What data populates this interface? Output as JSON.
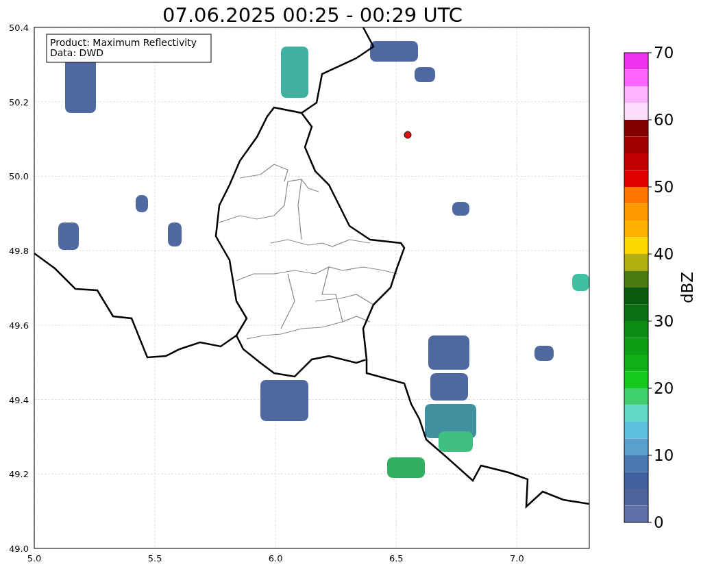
{
  "title": "07.06.2025 00:25 - 00:29 UTC",
  "map": {
    "info_lines": [
      "Product: Maximum Reflectivity",
      "Data: DWD"
    ],
    "xticks": [
      "5.0",
      "5.5",
      "6.0",
      "6.5",
      "7.0"
    ],
    "yticks": [
      "50.4",
      "50.2",
      "50.0",
      "49.8",
      "49.6",
      "49.4",
      "49.2",
      "49.0"
    ]
  },
  "colorbar": {
    "label": "dBZ",
    "ticks": [
      "70",
      "60",
      "50",
      "40",
      "30",
      "20",
      "10",
      "0"
    ],
    "bands": [
      {
        "color": "#ee33ee"
      },
      {
        "color": "#ff66ff"
      },
      {
        "color": "#ffb3ff"
      },
      {
        "color": "#ffddff"
      },
      {
        "color": "#800000"
      },
      {
        "color": "#a00000"
      },
      {
        "color": "#c00000"
      },
      {
        "color": "#e00000"
      },
      {
        "color": "#ff7700"
      },
      {
        "color": "#ff9900"
      },
      {
        "color": "#ffb300"
      },
      {
        "color": "#ffd700"
      },
      {
        "color": "#b0b010"
      },
      {
        "color": "#4a7a10"
      },
      {
        "color": "#0a5a10"
      },
      {
        "color": "#0b6e12"
      },
      {
        "color": "#0c8a14"
      },
      {
        "color": "#0e9e16"
      },
      {
        "color": "#10b018"
      },
      {
        "color": "#14c81c"
      },
      {
        "color": "#40d070"
      },
      {
        "color": "#60d8c8"
      },
      {
        "color": "#60c0e0"
      },
      {
        "color": "#5aa0cc"
      },
      {
        "color": "#4a7ab0"
      },
      {
        "color": "#4060a0"
      },
      {
        "color": "#50649c"
      },
      {
        "color": "#6070a8"
      }
    ]
  }
}
